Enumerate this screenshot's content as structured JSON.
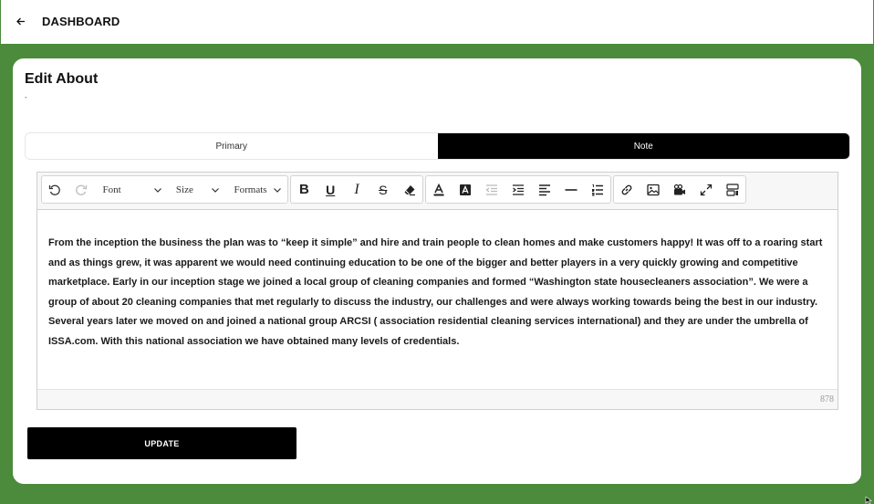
{
  "header": {
    "back_icon": "arrow-left-icon",
    "title": "DASHBOARD"
  },
  "card": {
    "title": "Edit About",
    "subtitle": "-"
  },
  "tabs": [
    {
      "label": "Primary",
      "active": false
    },
    {
      "label": "Note",
      "active": true
    }
  ],
  "toolbar": {
    "font_label": "Font",
    "size_label": "Size",
    "formats_label": "Formats",
    "icons": [
      "undo-icon",
      "redo-icon",
      "bold-icon",
      "underline-icon",
      "italic-icon",
      "strikethrough-icon",
      "eraser-icon",
      "font-color-icon",
      "highlight-color-icon",
      "outdent-icon",
      "indent-icon",
      "align-left-icon",
      "horizontal-rule-icon",
      "ordered-list-icon",
      "link-icon",
      "image-icon",
      "video-icon",
      "fullscreen-icon",
      "show-blocks-icon"
    ]
  },
  "editor": {
    "content": "From the inception the business the plan was to “keep it simple” and hire and train people to clean homes and make customers happy! It was off to a roaring start and as things grew, it was apparent we would need continuing education to be one of the bigger and better players in a very quickly growing and competitive marketplace. Early in our inception stage we joined a local group of cleaning companies and formed “Washington state housecleaners association”. We were a group of about 20 cleaning companies that met regularly to discuss the industry, our challenges and were always working towards being the best in our industry. Several years later we moved on and joined a national group ARCSI ( association residential cleaning services international) and they are under the umbrella of ISSA.com. With this national association we have obtained many levels of credentials.",
    "char_count": "878"
  },
  "actions": {
    "update_label": "UPDATE"
  },
  "colors": {
    "accent_green": "#4b8b3b",
    "primary_black": "#000000"
  }
}
